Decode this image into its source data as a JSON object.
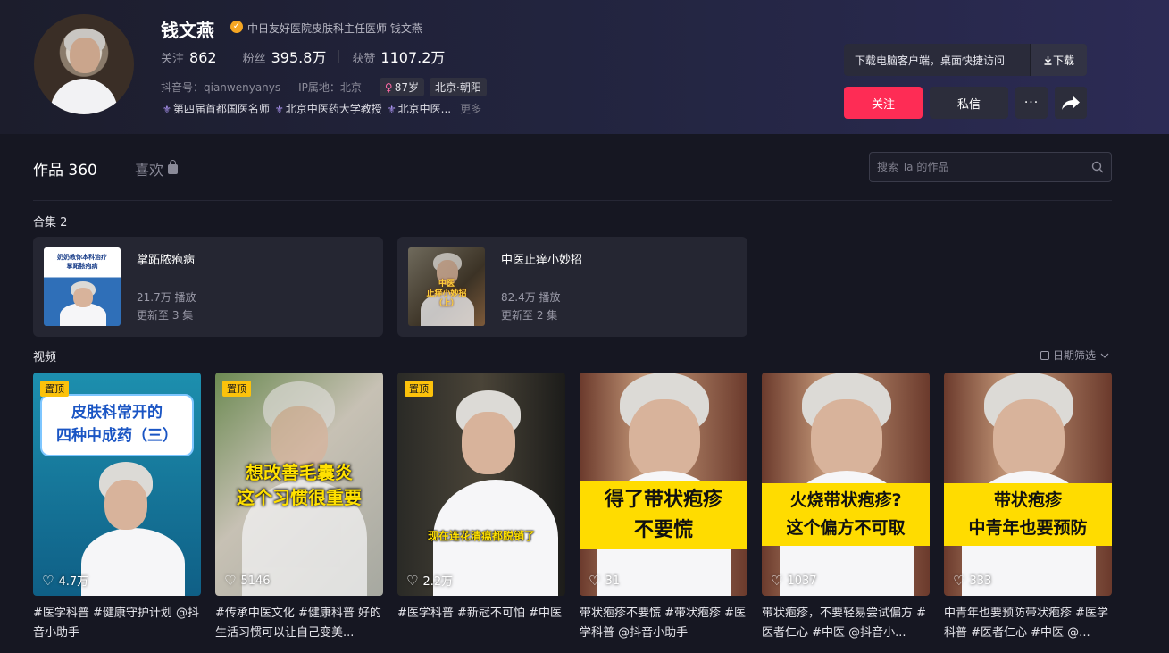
{
  "profile": {
    "name": "钱文燕",
    "verify_text": "中日友好医院皮肤科主任医师 钱文燕",
    "following_label": "关注",
    "following": "862",
    "fans_label": "粉丝",
    "fans": "395.8万",
    "likes_label": "获赞",
    "likes": "1107.2万",
    "douyin_id": "抖音号：qianwenyanys",
    "ip": "IP属地：北京",
    "age_tag": "87岁",
    "location_tag": "北京·朝阳",
    "honors": [
      "第四届首都国医名师",
      "北京中医药大学教授",
      "北京中医..."
    ],
    "more": "更多"
  },
  "actions": {
    "download_text": "下载电脑客户端，桌面快捷访问",
    "download_btn": "下载",
    "follow": "关注",
    "message": "私信",
    "more": "···"
  },
  "tabs": {
    "works": "作品 360",
    "likes": "喜欢"
  },
  "search": {
    "placeholder": "搜索 Ta 的作品"
  },
  "collections": {
    "title": "合集 2",
    "items": [
      {
        "title": "掌跖脓疱病",
        "plays": "21.7万 播放",
        "updated": "更新至 3 集",
        "thumb_text": "奶奶教你本科治疗\n掌跖脓疱病"
      },
      {
        "title": "中医止痒小妙招",
        "plays": "82.4万 播放",
        "updated": "更新至 2 集",
        "thumb_text": "中医\n止痒小妙招\n（上）"
      }
    ]
  },
  "videos": {
    "title": "视频",
    "date_filter": "日期筛选",
    "pin_label": "置顶",
    "items": [
      {
        "pinned": true,
        "likes": "4.7万",
        "overlay": "皮肤科常开的\n四种中成药（三）",
        "desc": "#医学科普 #健康守护计划 @抖音小助手"
      },
      {
        "pinned": true,
        "likes": "5146",
        "overlay": "想改善毛囊炎\n这个习惯很重要",
        "desc": "#传承中医文化 #健康科普 好的生活习惯可以让自己变美..."
      },
      {
        "pinned": true,
        "likes": "2.2万",
        "overlay": "现在连花清瘟都脱销了",
        "desc": "#医学科普 #新冠不可怕 #中医"
      },
      {
        "pinned": false,
        "likes": "31",
        "overlay": "得了带状疱疹\n不要慌",
        "desc": "带状疱疹不要慌 #带状疱疹 #医学科普 @抖音小助手"
      },
      {
        "pinned": false,
        "likes": "1037",
        "overlay": "火烧带状疱疹?\n这个偏方不可取",
        "desc": "带状疱疹，不要轻易尝试偏方 #医者仁心 #中医 @抖音小..."
      },
      {
        "pinned": false,
        "likes": "333",
        "overlay": "带状疱疹\n中青年也要预防",
        "desc": "中青年也要预防带状疱疹 #医学科普 #医者仁心 #中医 @..."
      }
    ]
  },
  "colors": {
    "accent": "#fe2c55",
    "pin": "#fcc20b",
    "banner": "#ffdc00",
    "bg": "#161722"
  },
  "icons": [
    "verified-icon",
    "download-icon",
    "share-icon",
    "lock-icon",
    "search-icon",
    "calendar-icon",
    "heart-icon",
    "honor-icon",
    "gender-icon"
  ]
}
